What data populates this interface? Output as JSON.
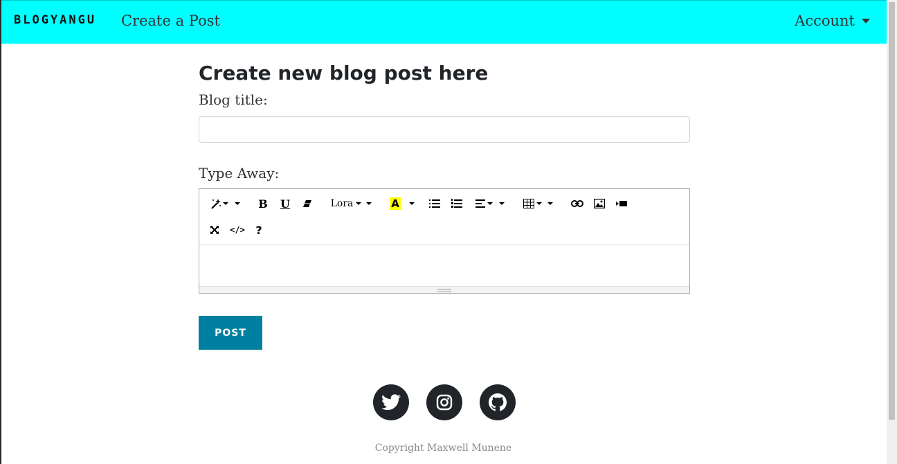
{
  "navbar": {
    "brand": "BLOGYANGU",
    "create_link": "Create a Post",
    "account_label": "Account",
    "bg_color": "#00ffff"
  },
  "main": {
    "title": "Create new blog post here",
    "blog_title_label": "Blog title:",
    "blog_title_value": "",
    "type_away_label": "Type Away:",
    "editor": {
      "toolbar": [
        "magic-icon",
        "bold-icon",
        "underline-icon",
        "eraser-icon",
        "font-name",
        "highlight-icon",
        "unordered-list-icon",
        "ordered-list-icon",
        "align-icon",
        "table-icon",
        "link-icon",
        "picture-icon",
        "video-icon",
        "fullscreen-icon",
        "code-view-icon",
        "help-icon"
      ],
      "font_name": "Lora",
      "bold_glyph": "B",
      "underline_glyph": "U",
      "highlight_glyph": "A",
      "help_glyph": "?",
      "code_glyph": "</>",
      "highlight_color": "#ffff00"
    },
    "post_button": "POST",
    "post_button_color": "#0080a0"
  },
  "social": [
    "twitter-icon",
    "instagram-icon",
    "github-icon"
  ],
  "footer": {
    "copyright": "Copyright Maxwell Munene"
  }
}
